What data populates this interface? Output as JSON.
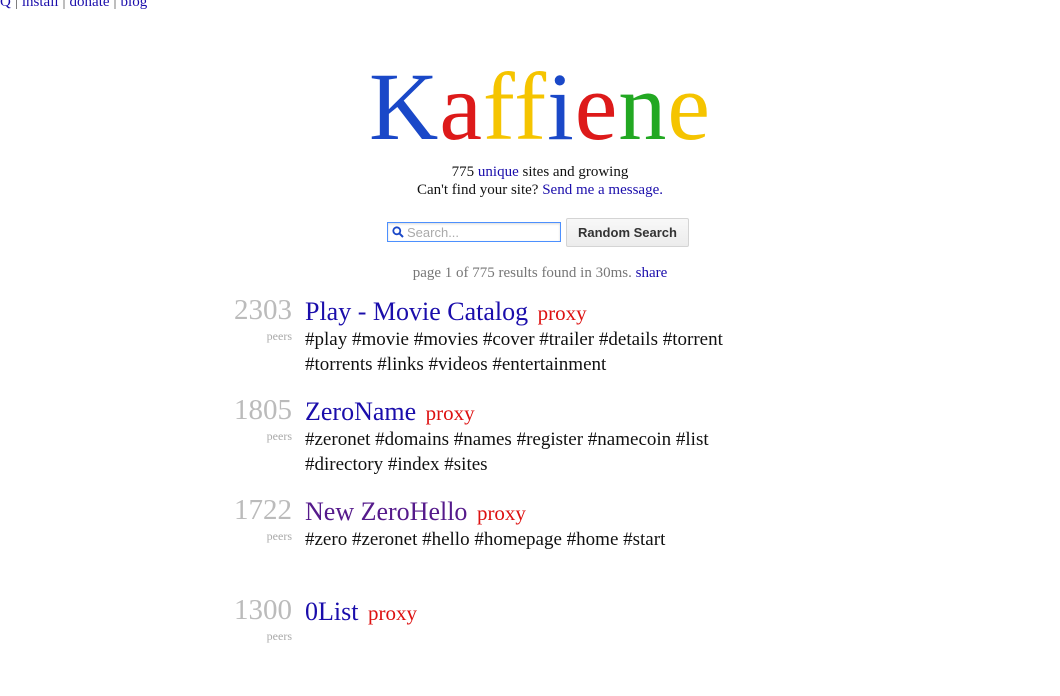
{
  "nav": {
    "partial_link": "Q",
    "links": [
      "install",
      "donate",
      "blog"
    ]
  },
  "logo": {
    "letters": [
      {
        "char": "K",
        "color": "#1a48c8"
      },
      {
        "char": "a",
        "color": "#dd1a1a"
      },
      {
        "char": "f",
        "color": "#f5c400"
      },
      {
        "char": "f",
        "color": "#f5c400"
      },
      {
        "char": "i",
        "color": "#1a48c8"
      },
      {
        "char": "e",
        "color": "#dd1a1a"
      },
      {
        "char": "n",
        "color": "#22a822"
      },
      {
        "char": "e",
        "color": "#f5c400"
      }
    ]
  },
  "stats": {
    "count": "775",
    "unique_link": "unique",
    "growing_text": "sites and growing",
    "cant_find_text": "Can't find your site?",
    "message_link": "Send me a message."
  },
  "search": {
    "placeholder": "Search...",
    "value": "",
    "random_label": "Random Search"
  },
  "result_info": {
    "text": "page 1 of 775 results found in 30ms.",
    "share_link": "share"
  },
  "results": [
    {
      "peers": "2303",
      "peers_label": "peers",
      "title": "Play - Movie Catalog",
      "visited": false,
      "proxy": "proxy",
      "tags": "#play #movie #movies #cover #trailer #details #torrent #torrents #links #videos #entertainment"
    },
    {
      "peers": "1805",
      "peers_label": "peers",
      "title": "ZeroName",
      "visited": false,
      "proxy": "proxy",
      "tags": "#zeronet #domains #names #register #namecoin #list #directory #index #sites"
    },
    {
      "peers": "1722",
      "peers_label": "peers",
      "title": "New ZeroHello",
      "visited": true,
      "proxy": "proxy",
      "tags": "#zero #zeronet #hello #homepage #home #start"
    },
    {
      "peers": "1300",
      "peers_label": "peers",
      "title": "0List",
      "visited": false,
      "proxy": "proxy",
      "tags": ""
    }
  ]
}
